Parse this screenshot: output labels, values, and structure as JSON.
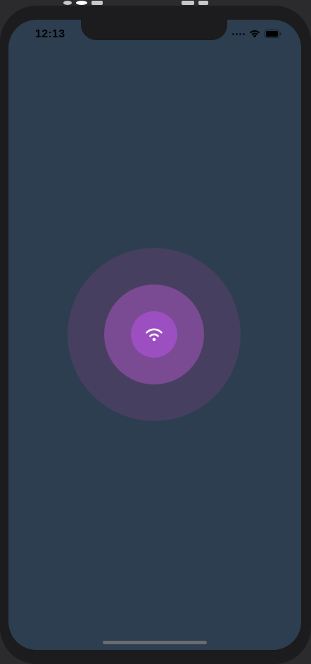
{
  "status_bar": {
    "time": "12:13",
    "signal_icon": "cellular-dots-icon",
    "wifi_icon": "wifi-icon",
    "battery_icon": "battery-icon"
  },
  "pulse": {
    "center_icon": "wifi-icon",
    "colors": {
      "background": "#2c3e50",
      "outer": "#463f5f",
      "middle": "#7a4a92",
      "inner": "#9b4fc0"
    }
  }
}
